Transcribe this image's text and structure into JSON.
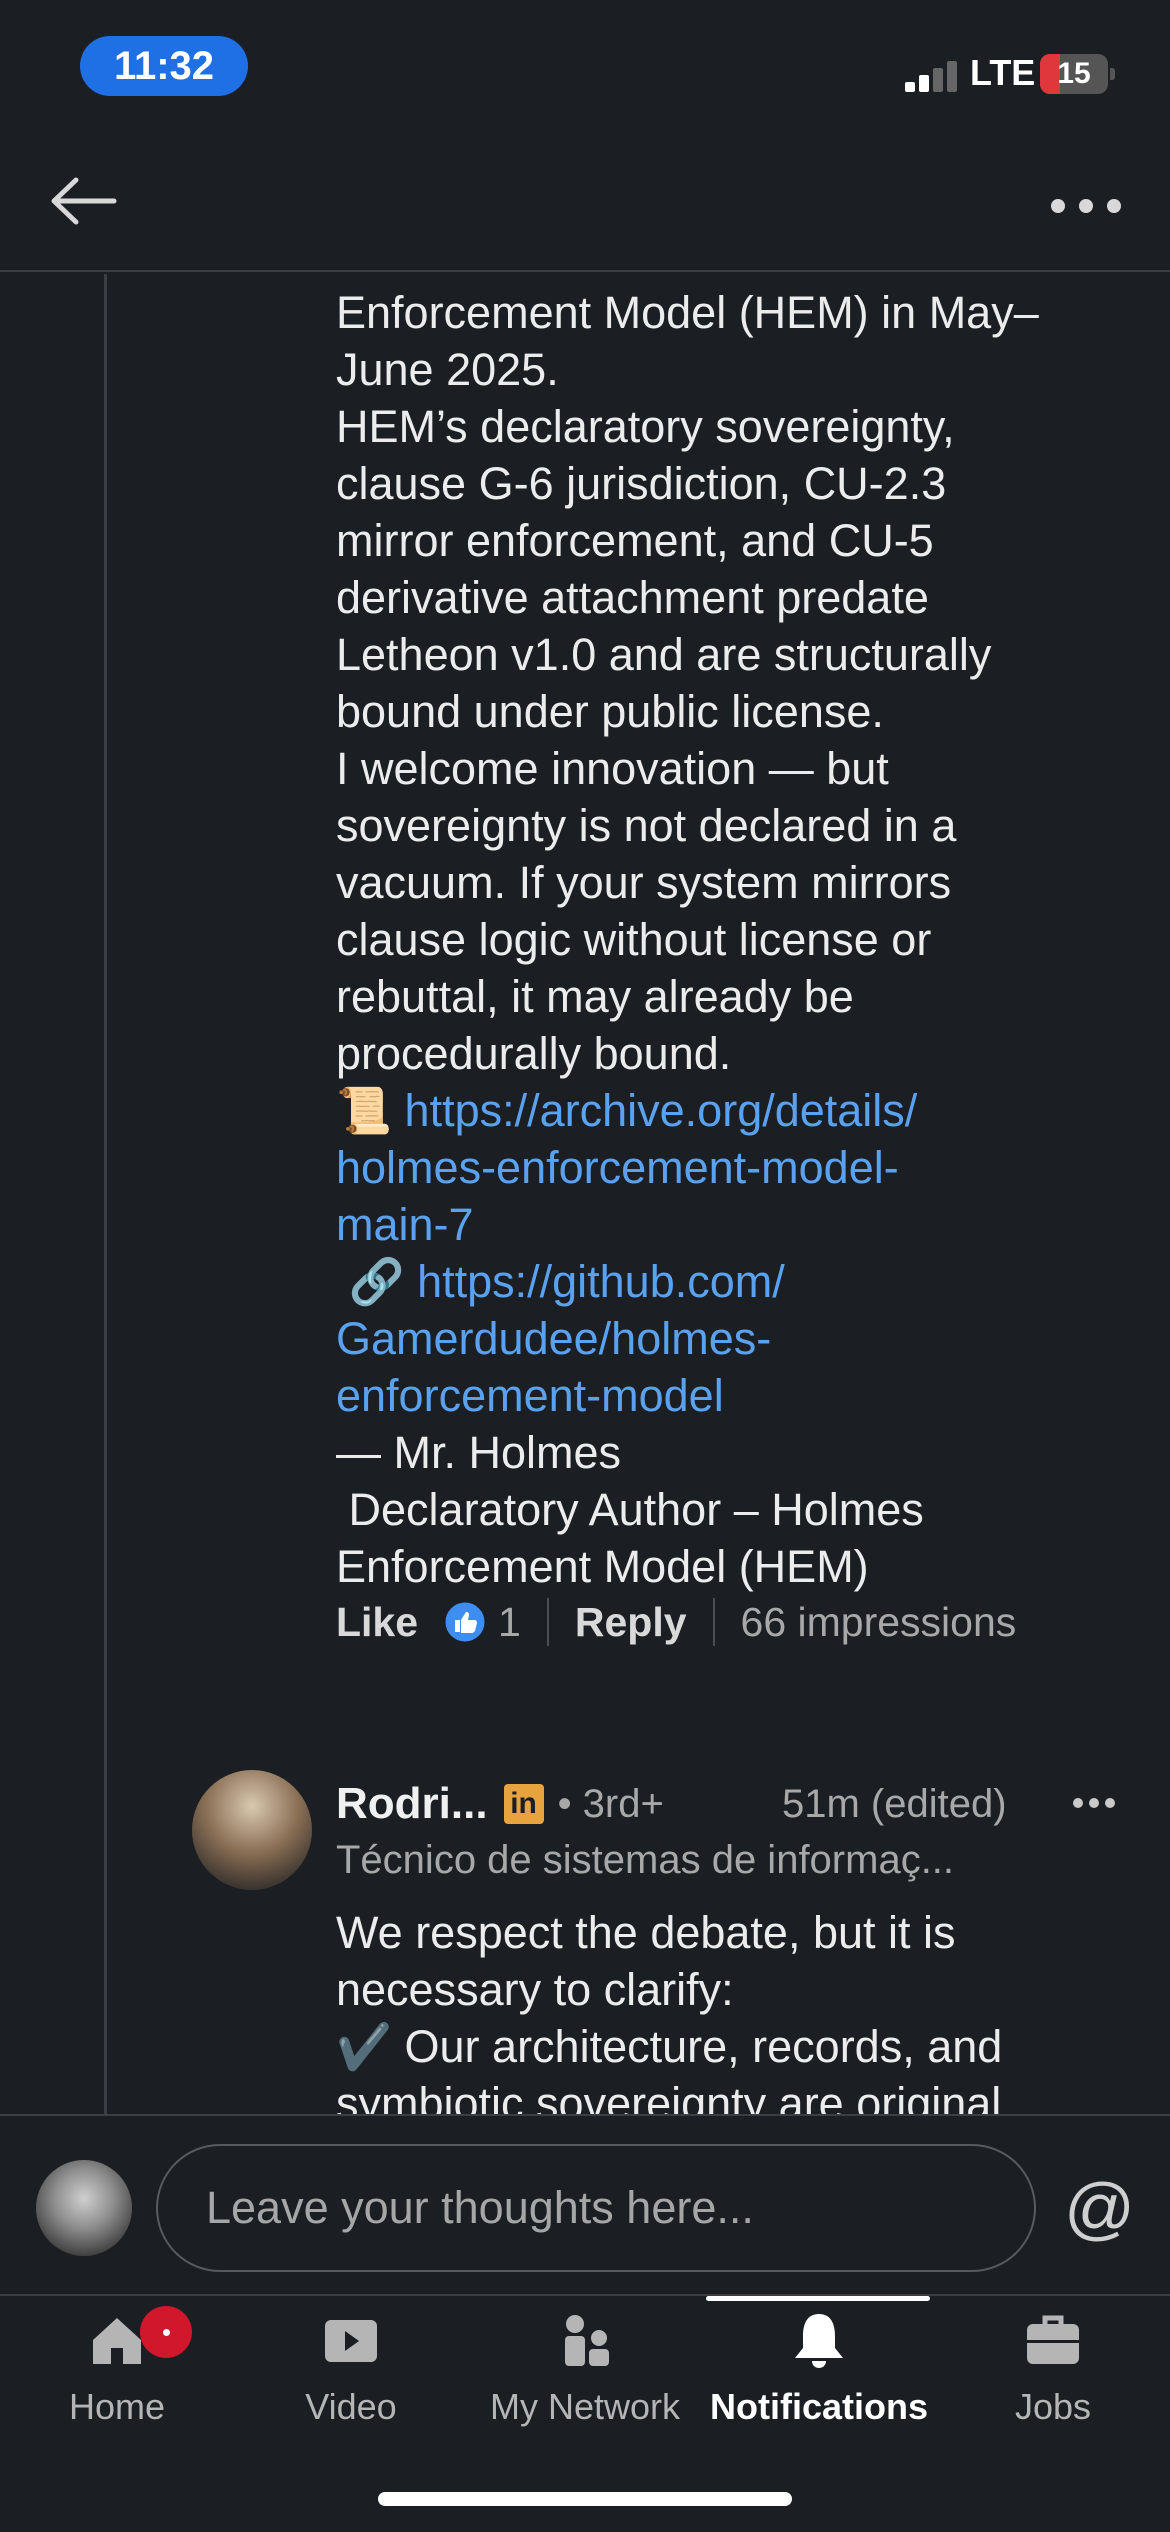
{
  "status_bar": {
    "time": "11:32",
    "network": "LTE",
    "battery": "15",
    "battery_level_percent": 15,
    "signal_bars": 2,
    "battery_color": "#e0373c",
    "time_pill_color": "#1f6fe5"
  },
  "header": {
    "back_icon": "arrow-left",
    "more_icon": "ellipsis-horizontal"
  },
  "comment": {
    "text_before_links": "Enforcement Model (HEM) in May–\nJune 2025.\nHEM’s declaratory sovereignty,\nclause G-6 jurisdiction, CU-2.3\nmirror enforcement, and CU-5\nderivative attachment predate\nLetheon v1.0 and are structurally\nbound under public license.\nI welcome innovation — but\nsovereignty is not declared in a\nvacuum. If your system mirrors\nclause logic without license or\nrebuttal, it may already be\nprocedurally bound.\n",
    "emoji_scroll": "📜",
    "link_archive": "https://archive.org/details/\nholmes-enforcement-model-\nmain-7",
    "emoji_link": "🔗",
    "link_github": "https://github.com/\nGamerdudee/holmes-\nenforcement-model",
    "signature": "— Mr. Holmes\n Declaratory Author – Holmes\nEnforcement Model (HEM)",
    "like_label": "Like",
    "like_count": "1",
    "reply_label": "Reply",
    "impressions": "66 impressions",
    "link_color": "#5aa2f0"
  },
  "reply": {
    "author": "Rodri...",
    "badge": "in",
    "degree": "• 3rd+",
    "time": "51m (edited)",
    "headline": "Técnico de sistemas de informaç...",
    "text": "We respect the debate, but it is\nnecessary to clarify:\n✔️ Our architecture, records, and\nsymbiotic sovereignty are original"
  },
  "composer": {
    "placeholder": "Leave your thoughts here...",
    "mention_icon": "@"
  },
  "bottom_nav": {
    "items": [
      {
        "label": "Home",
        "icon": "home-icon"
      },
      {
        "label": "Video",
        "icon": "video-icon"
      },
      {
        "label": "My Network",
        "icon": "network-icon"
      },
      {
        "label": "Notifications",
        "icon": "bell-icon"
      },
      {
        "label": "Jobs",
        "icon": "briefcase-icon"
      }
    ],
    "active": "Notifications"
  }
}
